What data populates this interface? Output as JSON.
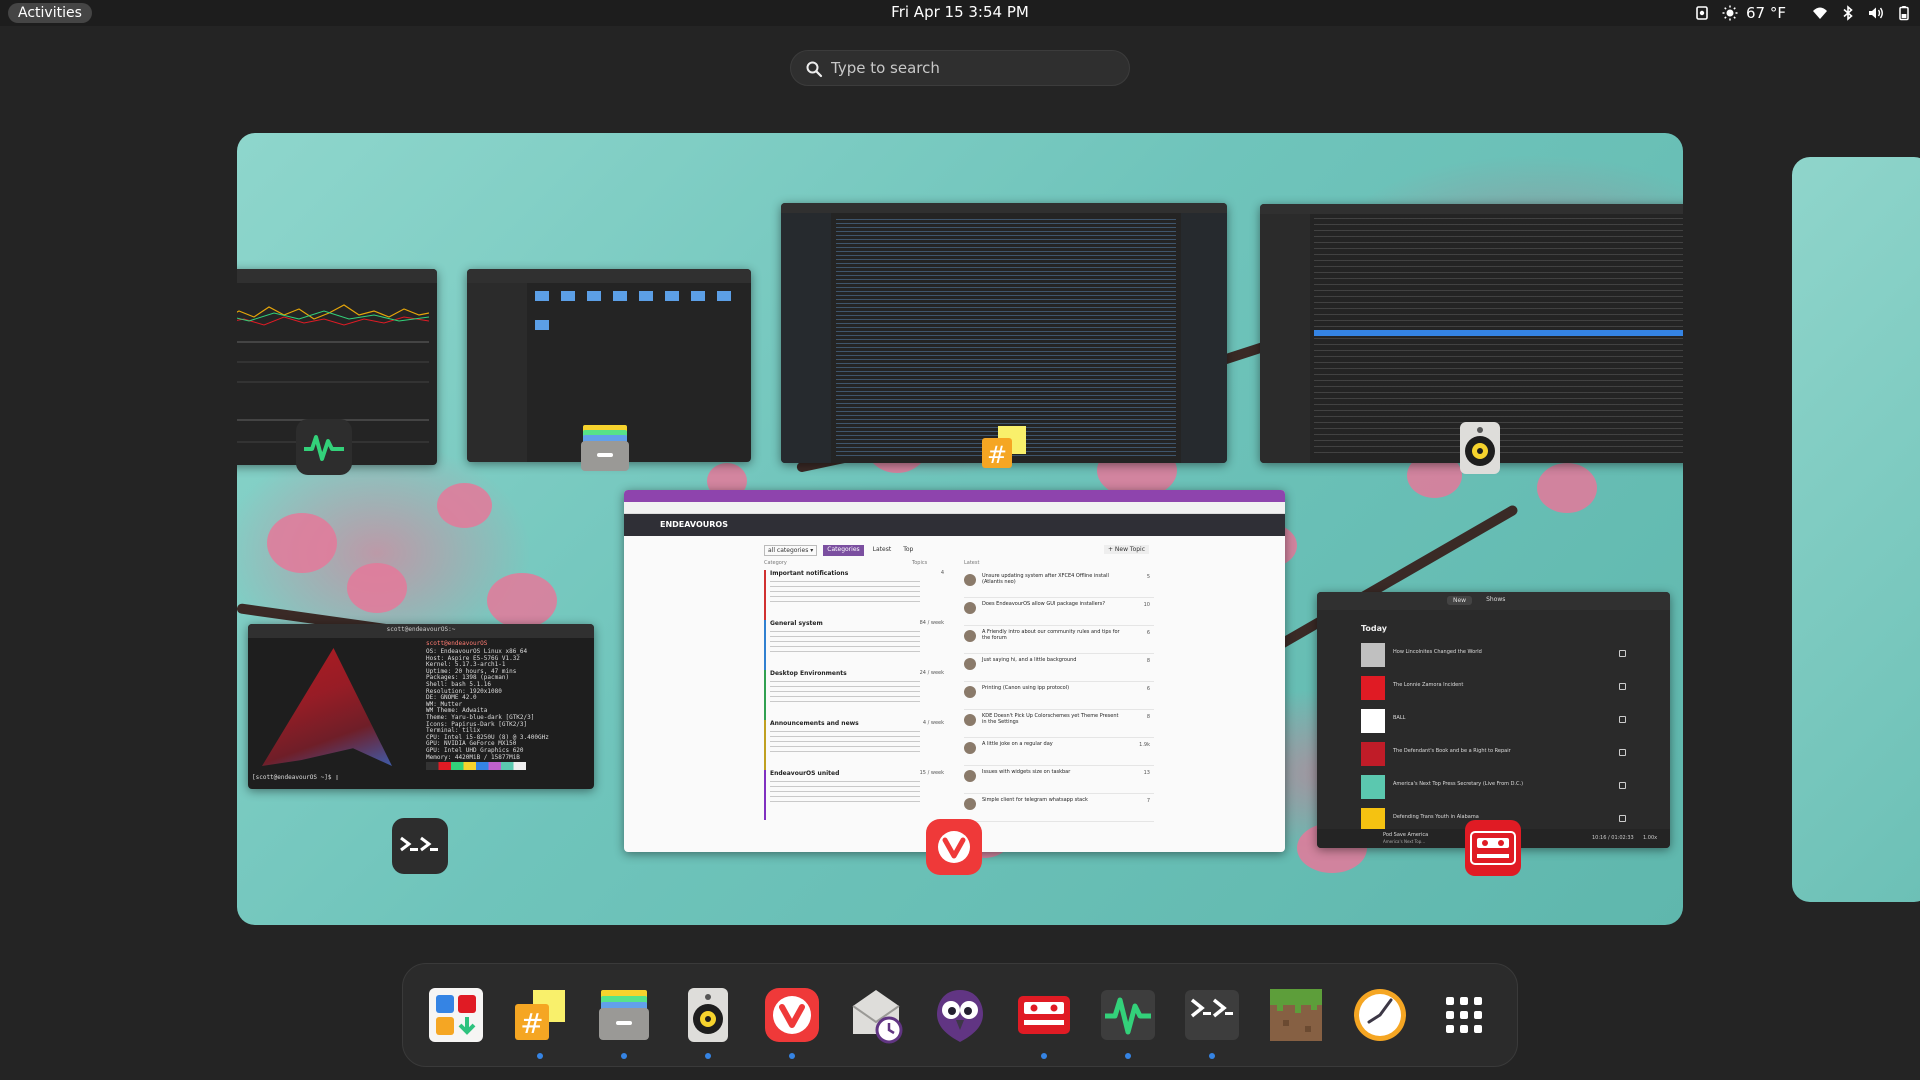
{
  "topbar": {
    "activities_label": "Activities",
    "clock": "Fri Apr 15   3:54 PM",
    "temperature": "67 °F",
    "icons": [
      "screenshot-icon",
      "weather-sun-icon",
      "wifi-icon",
      "bluetooth-icon",
      "volume-icon",
      "battery-icon"
    ]
  },
  "search": {
    "placeholder": "Type to search"
  },
  "windows": {
    "terminal": {
      "title": "scott@endeavourOS:~",
      "header": "scott@endeavourOS",
      "info": [
        "OS: EndeavourOS Linux x86_64",
        "Host: Aspire E5-576G V1.32",
        "Kernel: 5.17.3-arch1-1",
        "Uptime: 20 hours, 47 mins",
        "Packages: 1398 (pacman)",
        "Shell: bash 5.1.16",
        "Resolution: 1920x1080",
        "DE: GNOME 42.0",
        "WM: Mutter",
        "WM Theme: Adwaita",
        "Theme: Yaru-blue-dark [GTK2/3]",
        "Icons: Papirus-Dark [GTK2/3]",
        "Terminal: tilix",
        "CPU: Intel i5-8250U (8) @ 3.400GHz",
        "GPU: NVIDIA GeForce MX150",
        "GPU: Intel UHD Graphics 620",
        "Memory: 4420MiB / 15877MiB"
      ],
      "prompt": "[scott@endeavourOS ~]$ ▯"
    },
    "forum": {
      "site": "ENDEAVOUROS",
      "tabs": [
        "all categories ▾",
        "Categories",
        "Latest",
        "Top"
      ],
      "new_topic": "+ New Topic",
      "col_category": "Category",
      "col_topics": "Topics",
      "col_latest": "Latest",
      "categories": [
        {
          "name": "Important notifications",
          "count": "4",
          "color": "#d03030"
        },
        {
          "name": "General system",
          "count": "84 / week",
          "color": "#3080d0"
        },
        {
          "name": "Desktop Environments",
          "count": "24 / week",
          "color": "#30a050"
        },
        {
          "name": "Announcements and news",
          "count": "4 / week",
          "color": "#c0a020"
        },
        {
          "name": "EndeavourOS united",
          "count": "15 / week",
          "color": "#8030c0"
        }
      ],
      "latest": [
        {
          "title": "Unsure updating system after XFCE4 Offline install (Atlantis neo)",
          "n": "5"
        },
        {
          "title": "Does EndeavourOS allow GUI package installers?",
          "n": "10"
        },
        {
          "title": "A Friendly intro about our community rules and tips for the forum",
          "n": "6"
        },
        {
          "title": "Just saying hi, and a little background",
          "n": "8"
        },
        {
          "title": "Printing (Canon using ipp protocol)",
          "n": "6"
        },
        {
          "title": "KDE Doesn't Pick Up Colorschemes yet Theme Present in the Settings",
          "n": "8"
        },
        {
          "title": "A little joke on a regular day",
          "n": "1.9k"
        },
        {
          "title": "Issues with widgets size on taskbar",
          "n": "13"
        },
        {
          "title": "Simple client for telegram whatsapp stack",
          "n": "7"
        }
      ]
    },
    "podcasts": {
      "tab_new": "New",
      "tab_shows": "Shows",
      "section": "Today",
      "episodes": [
        "How Lincolnites Changed the World",
        "The Lonnie Zamora Incident",
        "BALL",
        "The Defendant's Book and be a Right to Repair",
        "America's Next Top Press Secretary (Live From D.C.)",
        "Defending Trans Youth in Alabama"
      ],
      "now_playing": "Pod Save America",
      "now_playing_sub": "America's Next Top...",
      "time": "10:16 / 01:02:33",
      "speed": "1.00x"
    }
  },
  "dock": {
    "apps": [
      {
        "name": "software-center",
        "running": false
      },
      {
        "name": "sticky-notes",
        "running": true
      },
      {
        "name": "files",
        "running": true
      },
      {
        "name": "rhythmbox",
        "running": true
      },
      {
        "name": "vivaldi",
        "running": true
      },
      {
        "name": "mail-scheduler",
        "running": false
      },
      {
        "name": "cawbird",
        "running": false
      },
      {
        "name": "podcasts",
        "running": true
      },
      {
        "name": "system-monitor",
        "running": true
      },
      {
        "name": "tilix-terminal",
        "running": true
      },
      {
        "name": "minecraft",
        "running": false
      },
      {
        "name": "clock",
        "running": false
      },
      {
        "name": "show-apps",
        "running": false
      }
    ]
  },
  "colors": {
    "accent": "#3584e4",
    "vivaldi_red": "#ef3939",
    "podcasts_red": "#e01b24",
    "monitor_green": "#26a269"
  }
}
